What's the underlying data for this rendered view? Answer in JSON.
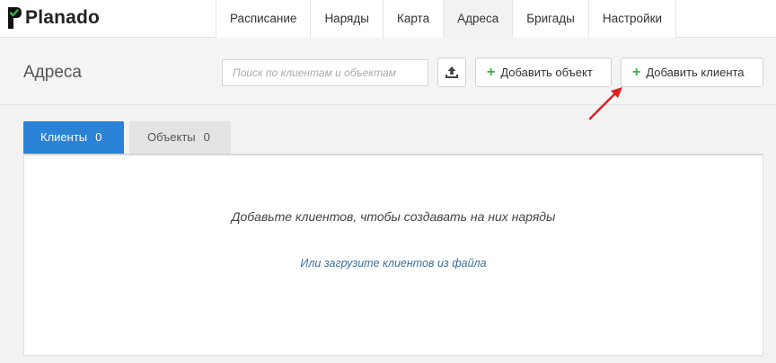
{
  "app": {
    "brand": "Planado"
  },
  "nav": {
    "items": [
      {
        "label": "Расписание"
      },
      {
        "label": "Наряды"
      },
      {
        "label": "Карта"
      },
      {
        "label": "Адреса",
        "active": true
      },
      {
        "label": "Бригады"
      },
      {
        "label": "Настройки"
      }
    ]
  },
  "header": {
    "title": "Адреса",
    "search_placeholder": "Поиск по клиентам и объектам",
    "add_object_label": "Добавить объект",
    "add_client_label": "Добавить клиента"
  },
  "tabs": [
    {
      "label": "Клиенты",
      "count": "0",
      "active": true
    },
    {
      "label": "Объекты",
      "count": "0",
      "active": false
    }
  ],
  "panel": {
    "empty_message": "Добавьте клиентов, чтобы создавать на них наряды",
    "upload_link": "Или загрузите клиентов из файла"
  },
  "colors": {
    "accent": "#2a83d6",
    "plus": "#3eaa4b",
    "link": "#3a6f9e",
    "annotation_arrow": "#e02020"
  },
  "icons": {
    "logo": "planado-logo-icon",
    "upload": "upload-icon",
    "plus": "plus-icon",
    "annotation": "red-arrow-annotation"
  }
}
